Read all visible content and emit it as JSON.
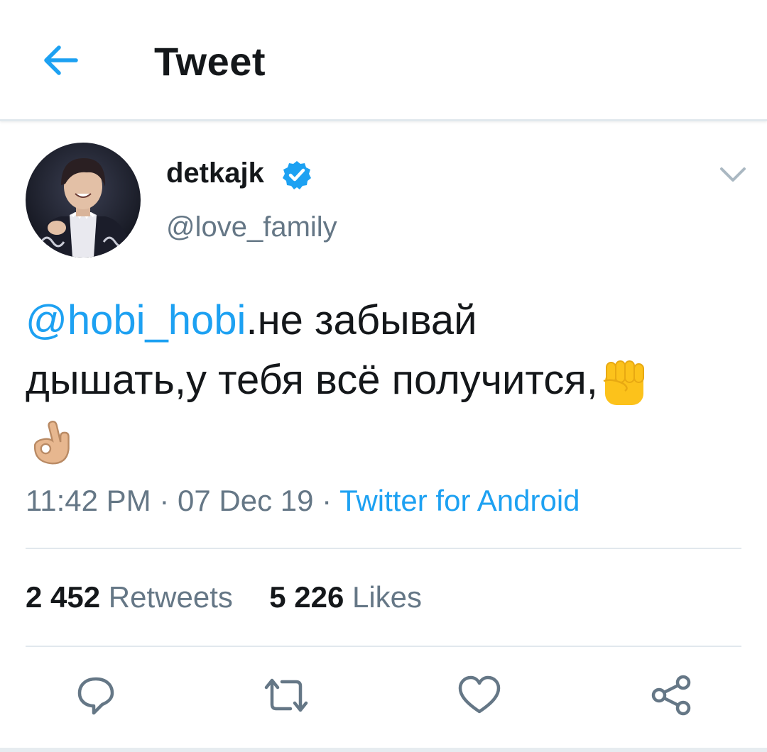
{
  "header": {
    "title": "Tweet",
    "back_icon": "arrow-left-icon"
  },
  "tweet": {
    "author": {
      "display_name": "detkajk",
      "handle": "@love_family",
      "verified": true,
      "verified_icon": "verified-badge-icon"
    },
    "text": {
      "mention": "@hobi_hobi",
      "body_line1": ".не забывай",
      "body_line2": "дышать,у тебя всё получится,",
      "emojis": [
        "raised-fist-emoji",
        "ok-hand-emoji"
      ]
    },
    "time": "11:42 PM",
    "date": "07 Dec 19",
    "separator": "·",
    "source": "Twitter for Android",
    "stats": {
      "retweets_count": "2 452",
      "retweets_label": "Retweets",
      "likes_count": "5 226",
      "likes_label": "Likes"
    }
  },
  "actions": [
    "reply-icon",
    "retweet-icon",
    "like-icon",
    "share-icon"
  ],
  "colors": {
    "accent": "#1da1f2",
    "text_primary": "#14171a",
    "text_secondary": "#657786",
    "divider": "#e1e8ed"
  }
}
